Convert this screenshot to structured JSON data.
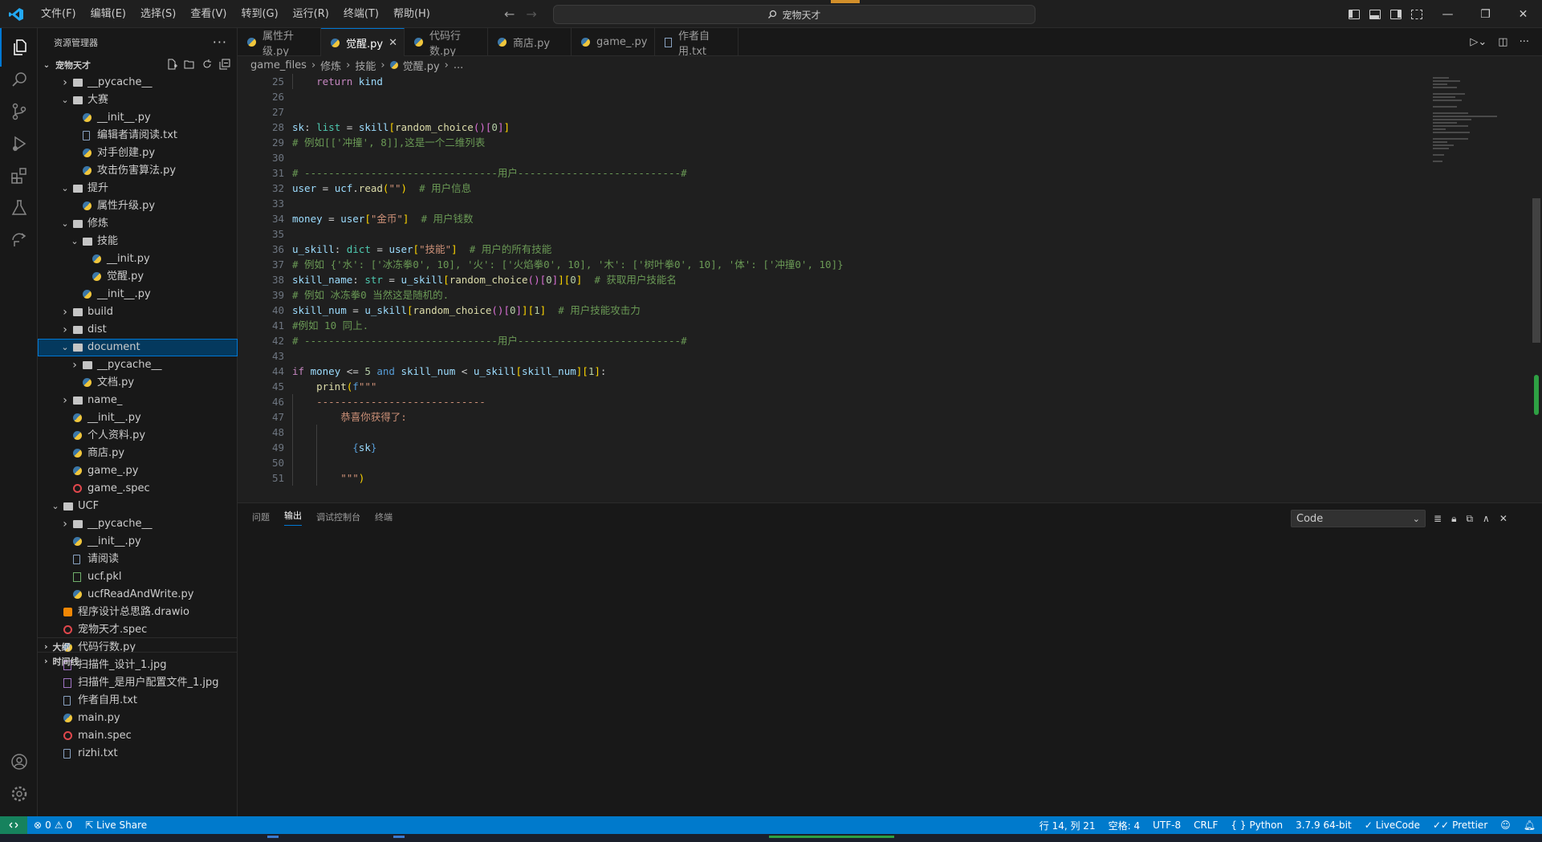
{
  "menu": [
    "文件(F)",
    "编辑(E)",
    "选择(S)",
    "查看(V)",
    "转到(G)",
    "运行(R)",
    "终端(T)",
    "帮助(H)"
  ],
  "search": {
    "text": "宠物天才"
  },
  "sidebar": {
    "title": "资源管理器",
    "root": "宠物天才",
    "outline": "大纲",
    "timeline": "时间线",
    "tree": [
      {
        "label": "__pycache__",
        "depth": 1,
        "type": "folder",
        "open": false
      },
      {
        "label": "大赛",
        "depth": 1,
        "type": "folder",
        "open": true
      },
      {
        "label": "__init__.py",
        "depth": 2,
        "type": "py"
      },
      {
        "label": "编辑者请阅读.txt",
        "depth": 2,
        "type": "txt"
      },
      {
        "label": "对手创建.py",
        "depth": 2,
        "type": "py"
      },
      {
        "label": "攻击伤害算法.py",
        "depth": 2,
        "type": "py"
      },
      {
        "label": "提升",
        "depth": 1,
        "type": "folder",
        "open": true
      },
      {
        "label": "属性升级.py",
        "depth": 2,
        "type": "py"
      },
      {
        "label": "修炼",
        "depth": 1,
        "type": "folder",
        "open": true
      },
      {
        "label": "技能",
        "depth": 2,
        "type": "folder",
        "open": true
      },
      {
        "label": "__init.py",
        "depth": 3,
        "type": "py"
      },
      {
        "label": "觉醒.py",
        "depth": 3,
        "type": "py"
      },
      {
        "label": "__init__.py",
        "depth": 2,
        "type": "py"
      },
      {
        "label": "build",
        "depth": 1,
        "type": "folder",
        "open": false
      },
      {
        "label": "dist",
        "depth": 1,
        "type": "folder",
        "open": false
      },
      {
        "label": "document",
        "depth": 1,
        "type": "folder",
        "open": true,
        "selected": true
      },
      {
        "label": "__pycache__",
        "depth": 2,
        "type": "folder",
        "open": false
      },
      {
        "label": "文档.py",
        "depth": 2,
        "type": "py"
      },
      {
        "label": "name_",
        "depth": 1,
        "type": "folder",
        "open": false
      },
      {
        "label": "__init__.py",
        "depth": 1,
        "type": "py"
      },
      {
        "label": "个人资料.py",
        "depth": 1,
        "type": "py"
      },
      {
        "label": "商店.py",
        "depth": 1,
        "type": "py"
      },
      {
        "label": "game_.py",
        "depth": 1,
        "type": "py"
      },
      {
        "label": "game_.spec",
        "depth": 1,
        "type": "spec"
      },
      {
        "label": "UCF",
        "depth": 0,
        "type": "folder",
        "open": true
      },
      {
        "label": "__pycache__",
        "depth": 1,
        "type": "folder",
        "open": false
      },
      {
        "label": "__init__.py",
        "depth": 1,
        "type": "py"
      },
      {
        "label": "请阅读",
        "depth": 1,
        "type": "txt"
      },
      {
        "label": "ucf.pkl",
        "depth": 1,
        "type": "pkl"
      },
      {
        "label": "ucfReadAndWrite.py",
        "depth": 1,
        "type": "py"
      },
      {
        "label": "程序设计总思路.drawio",
        "depth": 0,
        "type": "drawio"
      },
      {
        "label": "宠物天才.spec",
        "depth": 0,
        "type": "spec"
      },
      {
        "label": "代码行数.py",
        "depth": 0,
        "type": "py"
      },
      {
        "label": "扫描件_设计_1.jpg",
        "depth": 0,
        "type": "jpg"
      },
      {
        "label": "扫描件_是用户配置文件_1.jpg",
        "depth": 0,
        "type": "jpg"
      },
      {
        "label": "作者自用.txt",
        "depth": 0,
        "type": "txt"
      },
      {
        "label": "main.py",
        "depth": 0,
        "type": "py"
      },
      {
        "label": "main.spec",
        "depth": 0,
        "type": "spec"
      },
      {
        "label": "rizhi.txt",
        "depth": 0,
        "type": "txt"
      }
    ]
  },
  "tabs": [
    {
      "label": "属性升级.py",
      "type": "py"
    },
    {
      "label": "觉醒.py",
      "type": "py",
      "active": true
    },
    {
      "label": "代码行数.py",
      "type": "py"
    },
    {
      "label": "商店.py",
      "type": "py"
    },
    {
      "label": "game_.py",
      "type": "py"
    },
    {
      "label": "作者自用.txt",
      "type": "txt"
    }
  ],
  "breadcrumb": [
    "game_files",
    "修炼",
    "技能",
    "觉醒.py",
    "..."
  ],
  "editor": {
    "first_line": 25,
    "lines": [
      [
        [
          "    ",
          ""
        ],
        [
          "return",
          "kw2"
        ],
        [
          " kind",
          "var"
        ]
      ],
      [],
      [],
      [
        [
          "sk",
          "var"
        ],
        [
          ": ",
          ""
        ],
        [
          "list",
          "ty"
        ],
        [
          " = ",
          ""
        ],
        [
          "skill",
          "var"
        ],
        [
          "[",
          "br1"
        ],
        [
          "random_choice",
          "fn"
        ],
        [
          "()",
          "br2"
        ],
        [
          "[",
          "br2"
        ],
        [
          "0",
          "num"
        ],
        [
          "]",
          "br2"
        ],
        [
          "]",
          "br1"
        ]
      ],
      [
        [
          "# 例如[['冲撞', 8]],这是一个二维列表",
          "cm"
        ]
      ],
      [],
      [
        [
          "# --------------------------------用户---------------------------#",
          "cm"
        ]
      ],
      [
        [
          "user",
          "var"
        ],
        [
          " = ",
          ""
        ],
        [
          "ucf",
          "var"
        ],
        [
          ".",
          ""
        ],
        [
          "read",
          "fn"
        ],
        [
          "(",
          "br1"
        ],
        [
          "\"\"",
          "str"
        ],
        [
          ")",
          "br1"
        ],
        [
          "  # 用户信息",
          "cm"
        ]
      ],
      [],
      [
        [
          "money",
          "var"
        ],
        [
          " = ",
          ""
        ],
        [
          "user",
          "var"
        ],
        [
          "[",
          "br1"
        ],
        [
          "\"金币\"",
          "str"
        ],
        [
          "]",
          "br1"
        ],
        [
          "  # 用户钱数",
          "cm"
        ]
      ],
      [],
      [
        [
          "u_skill",
          "var"
        ],
        [
          ": ",
          ""
        ],
        [
          "dict",
          "ty"
        ],
        [
          " = ",
          ""
        ],
        [
          "user",
          "var"
        ],
        [
          "[",
          "br1"
        ],
        [
          "\"技能\"",
          "str"
        ],
        [
          "]",
          "br1"
        ],
        [
          "  # 用户的所有技能",
          "cm"
        ]
      ],
      [
        [
          "# 例如 {'水': ['冰冻拳0', 10], '火': ['火焰拳0', 10], '木': ['树叶拳0', 10], '体': ['冲撞0', 10]}",
          "cm"
        ]
      ],
      [
        [
          "skill_name",
          "var"
        ],
        [
          ": ",
          ""
        ],
        [
          "str",
          "ty"
        ],
        [
          " = ",
          ""
        ],
        [
          "u_skill",
          "var"
        ],
        [
          "[",
          "br1"
        ],
        [
          "random_choice",
          "fn"
        ],
        [
          "()",
          "br2"
        ],
        [
          "[",
          "br2"
        ],
        [
          "0",
          "num"
        ],
        [
          "]",
          "br2"
        ],
        [
          "]",
          "br1"
        ],
        [
          "[",
          "br1"
        ],
        [
          "0",
          "num"
        ],
        [
          "]",
          "br1"
        ],
        [
          "  # 获取用户技能名",
          "cm"
        ]
      ],
      [
        [
          "# 例如 冰冻拳0 当然这是随机的.",
          "cm"
        ]
      ],
      [
        [
          "skill_num",
          "var"
        ],
        [
          " = ",
          ""
        ],
        [
          "u_skill",
          "var"
        ],
        [
          "[",
          "br1"
        ],
        [
          "random_choice",
          "fn"
        ],
        [
          "()",
          "br2"
        ],
        [
          "[",
          "br2"
        ],
        [
          "0",
          "num"
        ],
        [
          "]",
          "br2"
        ],
        [
          "]",
          "br1"
        ],
        [
          "[",
          "br1"
        ],
        [
          "1",
          "num"
        ],
        [
          "]",
          "br1"
        ],
        [
          "  # 用户技能攻击力",
          "cm"
        ]
      ],
      [
        [
          "#例如 10 同上.",
          "cm"
        ]
      ],
      [
        [
          "# --------------------------------用户---------------------------#",
          "cm"
        ]
      ],
      [],
      [
        [
          "if",
          "kw2"
        ],
        [
          " money",
          "var"
        ],
        [
          " <= ",
          ""
        ],
        [
          "5",
          "num"
        ],
        [
          " and",
          "kw"
        ],
        [
          " skill_num",
          "var"
        ],
        [
          " < ",
          ""
        ],
        [
          "u_skill",
          "var"
        ],
        [
          "[",
          "br1"
        ],
        [
          "skill_num",
          "var"
        ],
        [
          "]",
          "br1"
        ],
        [
          "[",
          "br1"
        ],
        [
          "1",
          "num"
        ],
        [
          "]",
          "br1"
        ],
        [
          ":",
          ""
        ]
      ],
      [
        [
          "    ",
          ""
        ],
        [
          "print",
          "fn"
        ],
        [
          "(",
          "br1"
        ],
        [
          "f",
          "kw"
        ],
        [
          "\"\"\"",
          "str"
        ]
      ],
      [
        [
          "    ----------------------------",
          "str"
        ]
      ],
      [
        [
          "        恭喜你获得了:",
          "str"
        ]
      ],
      [],
      [
        [
          "          ",
          "str"
        ],
        [
          "{",
          "kw"
        ],
        [
          "sk",
          "var"
        ],
        [
          "}",
          "kw"
        ]
      ],
      [],
      [
        [
          "        \"\"\"",
          "str"
        ],
        [
          ")",
          "br1"
        ]
      ]
    ]
  },
  "panel": {
    "tabs": [
      "问题",
      "输出",
      "调试控制台",
      "终端"
    ],
    "active_tab": "输出",
    "select_value": "Code"
  },
  "status": {
    "errors": "0",
    "warnings": "0",
    "live_share": "Live Share",
    "position": "行 14, 列 21",
    "spaces": "空格: 4",
    "encoding": "UTF-8",
    "eol": "CRLF",
    "language": "Python",
    "interpreter": "3.7.9 64-bit",
    "livecode": "LiveCode",
    "prettier": "Prettier"
  },
  "colors": {
    "accent": "#0078d4",
    "statusbar": "#007acc",
    "remote": "#16825d"
  }
}
